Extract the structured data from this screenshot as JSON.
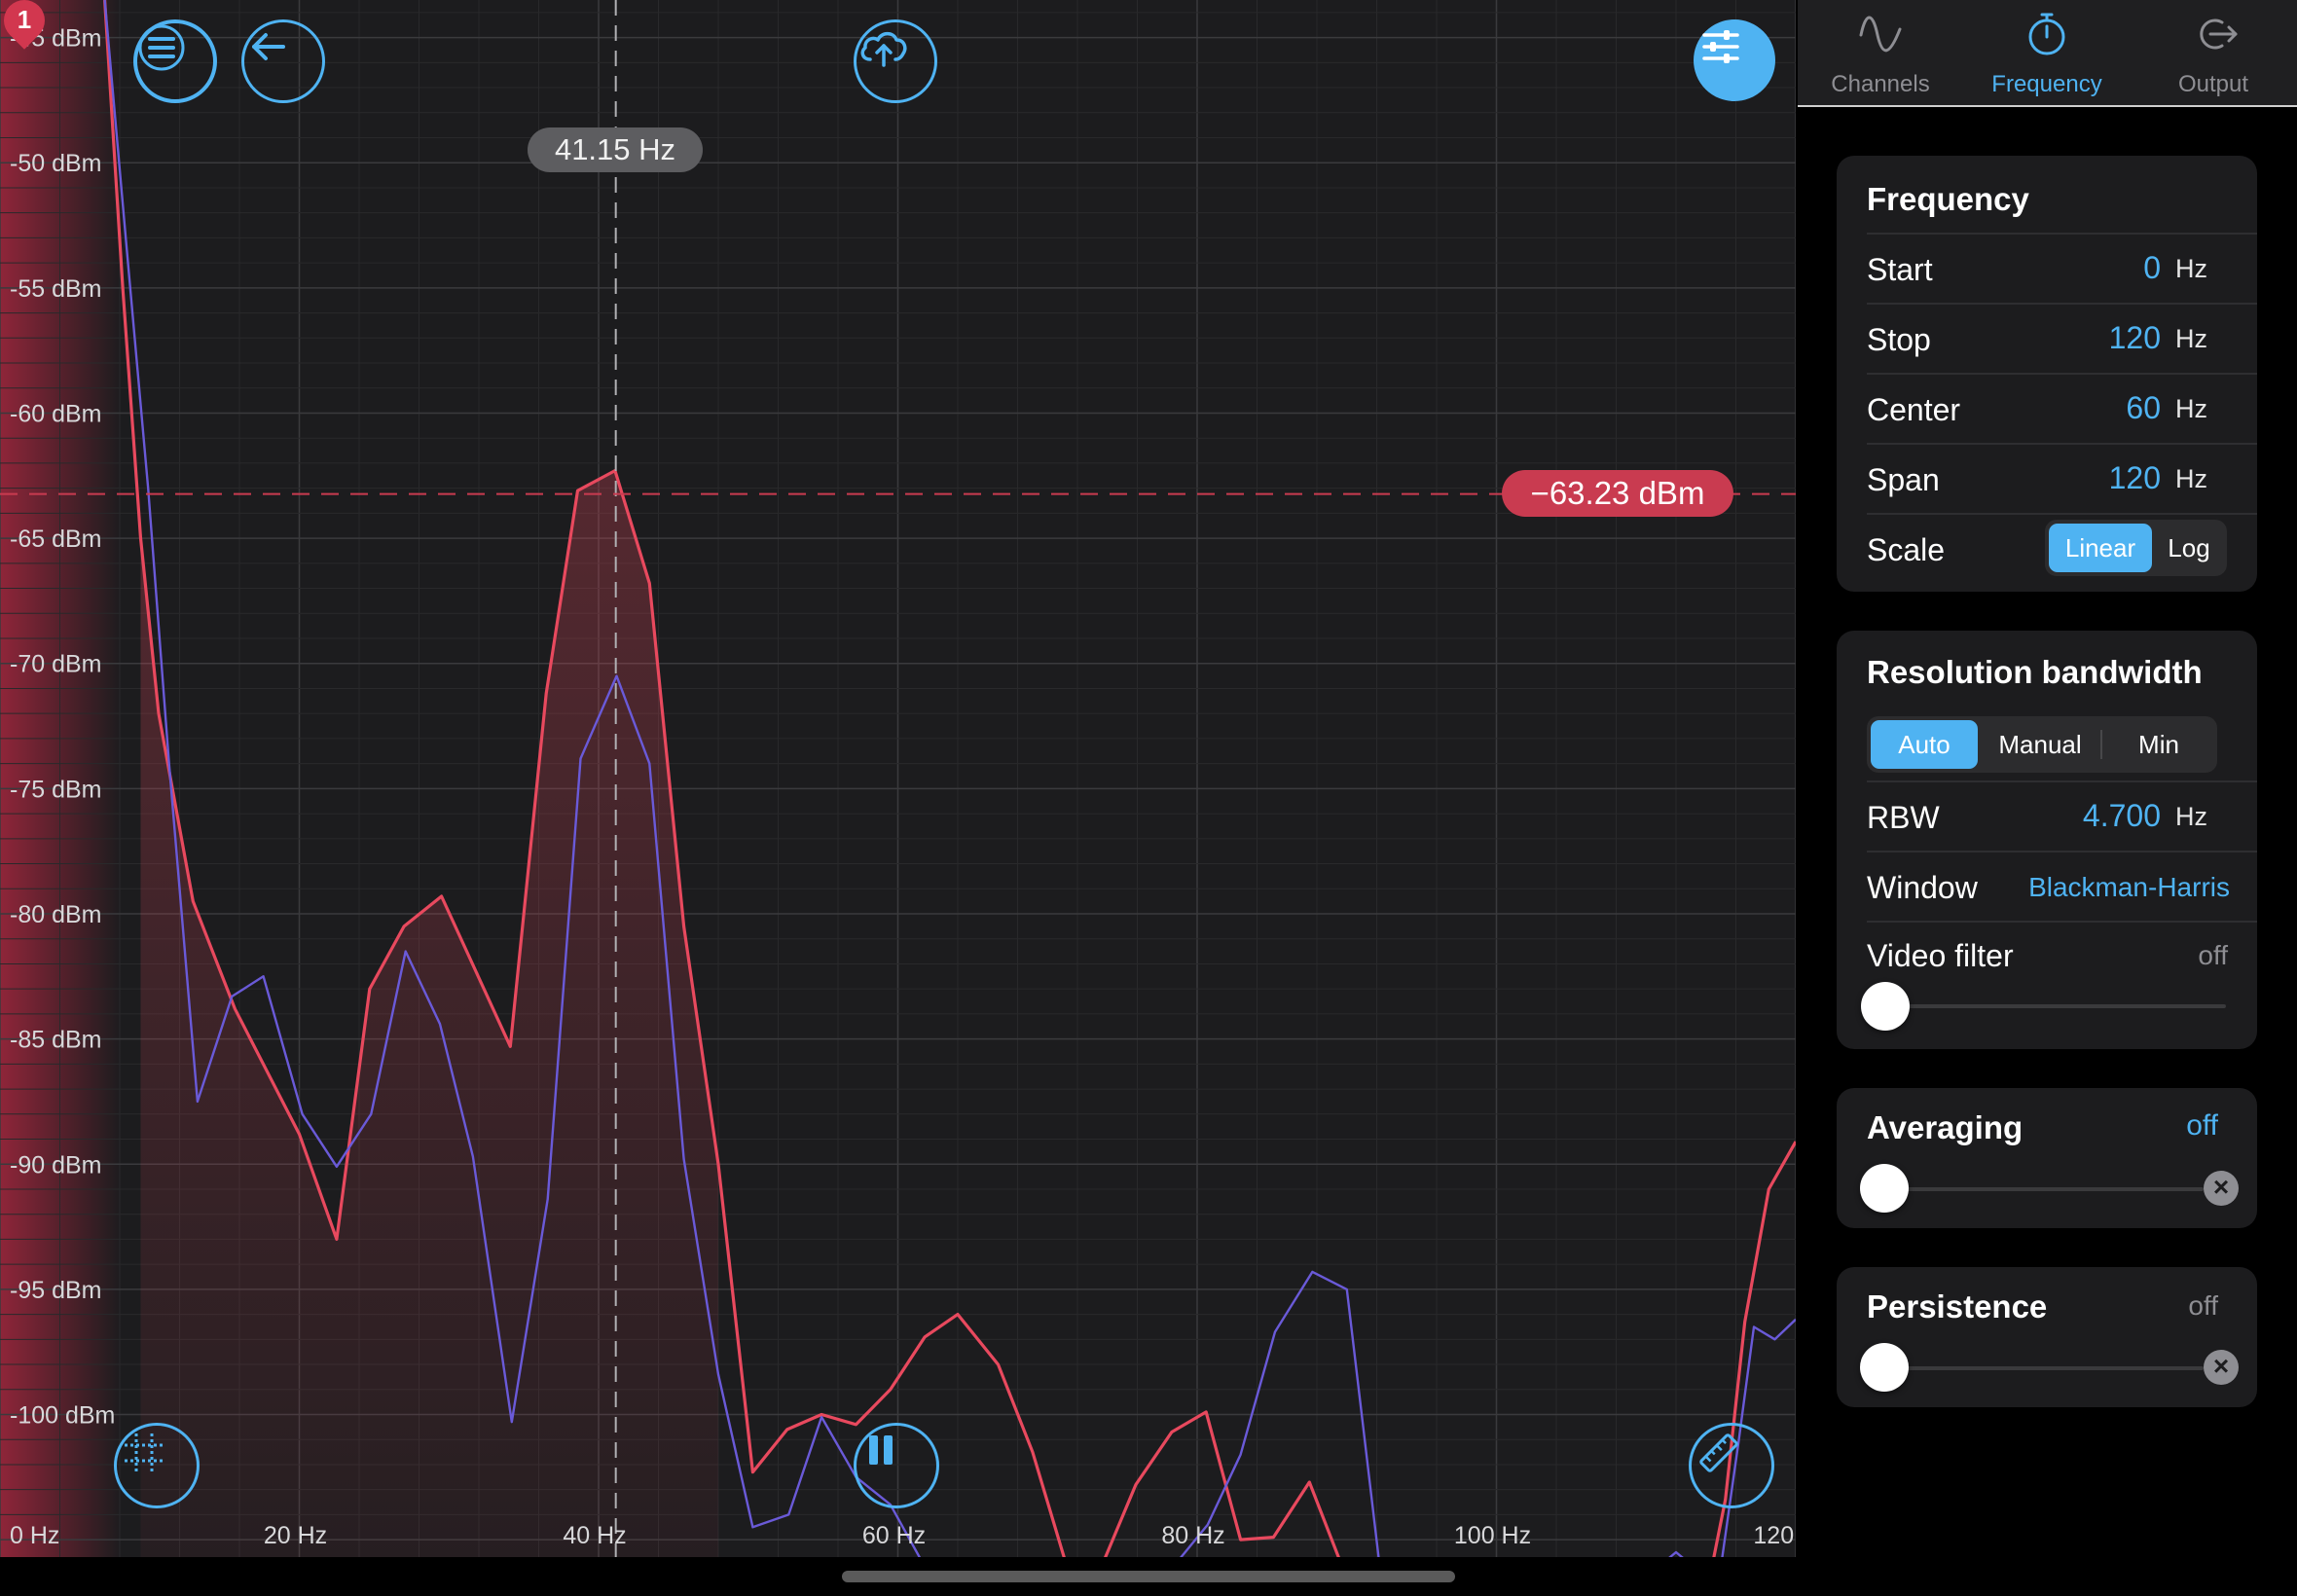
{
  "chart_data": {
    "type": "line",
    "title": "",
    "xlabel": "",
    "ylabel": "",
    "xlim": [
      0,
      120
    ],
    "ylim": [
      -105.5,
      -43.5
    ],
    "grid": true,
    "x_ticks": [
      {
        "value": 0,
        "label": "0 Hz"
      },
      {
        "value": 20,
        "label": "20 Hz"
      },
      {
        "value": 40,
        "label": "40 Hz"
      },
      {
        "value": 60,
        "label": "60 Hz"
      },
      {
        "value": 80,
        "label": "80 Hz"
      },
      {
        "value": 100,
        "label": "100 Hz"
      },
      {
        "value": 120,
        "label": "120 Hz"
      }
    ],
    "y_ticks": [
      {
        "value": -45,
        "label": "-45 dBm"
      },
      {
        "value": -50,
        "label": "-50 dBm"
      },
      {
        "value": -55,
        "label": "-55 dBm"
      },
      {
        "value": -60,
        "label": "-60 dBm"
      },
      {
        "value": -65,
        "label": "-65 dBm"
      },
      {
        "value": -70,
        "label": "-70 dBm"
      },
      {
        "value": -75,
        "label": "-75 dBm"
      },
      {
        "value": -80,
        "label": "-80 dBm"
      },
      {
        "value": -85,
        "label": "-85 dBm"
      },
      {
        "value": -90,
        "label": "-90 dBm"
      },
      {
        "value": -95,
        "label": "-95 dBm"
      },
      {
        "value": -100,
        "label": "-100 dBm"
      }
    ],
    "series": [
      {
        "color": "#e8495e",
        "x": [
          7.0,
          8.2,
          9.4,
          10.6,
          12.9,
          15.7,
          20.0,
          22.5,
          24.7,
          27.0,
          29.5,
          34.1,
          36.5,
          38.6,
          41.1,
          43.4,
          45.7,
          48.0,
          50.3,
          52.6,
          54.9,
          57.2,
          59.5,
          61.8,
          64.0,
          66.7,
          69.0,
          71.3,
          73.6,
          75.9,
          78.3,
          80.6,
          82.9,
          85.1,
          87.5,
          89.7,
          92.0,
          94.3,
          114.4,
          115.3,
          116.6,
          118.2,
          120.0
        ],
        "y": [
          -43.5,
          -55.0,
          -65.0,
          -72.0,
          -79.5,
          -83.8,
          -88.8,
          -93.0,
          -83.0,
          -80.5,
          -79.3,
          -85.3,
          -71.2,
          -63.1,
          -62.3,
          -66.8,
          -80.5,
          -90.0,
          -102.3,
          -100.6,
          -100.0,
          -100.4,
          -99.0,
          -96.9,
          -96.0,
          -98.0,
          -101.5,
          -109.0,
          -109.0,
          -102.8,
          -100.7,
          -99.9,
          -105.0,
          -104.9,
          -102.7,
          -109.0,
          -109.0,
          -109.0,
          -109.0,
          -103.4,
          -96.3,
          -91.0,
          -89.1
        ]
      },
      {
        "color": "#6a5ad8",
        "x": [
          7.0,
          8.4,
          9.9,
          11.3,
          13.2,
          15.5,
          17.6,
          20.2,
          22.5,
          24.8,
          27.1,
          29.4,
          31.6,
          34.2,
          36.6,
          38.8,
          41.2,
          43.4,
          45.7,
          48.0,
          50.3,
          52.7,
          54.9,
          57.2,
          59.5,
          61.8,
          64.2,
          66.6,
          69.3,
          71.6,
          73.9,
          76.2,
          78.4,
          80.7,
          82.9,
          85.2,
          87.7,
          90.0,
          92.2,
          94.5,
          99.5,
          104.5,
          109.0,
          110.4,
          111.0,
          112.0,
          113.0,
          114.0,
          115.0,
          116.2,
          117.2,
          118.6,
          120.0
        ],
        "y": [
          -43.5,
          -53.0,
          -63.0,
          -74.0,
          -87.5,
          -83.3,
          -82.5,
          -88.0,
          -90.1,
          -88.0,
          -81.5,
          -84.4,
          -89.7,
          -100.3,
          -91.4,
          -73.8,
          -70.5,
          -74.0,
          -89.8,
          -98.4,
          -104.5,
          -104.0,
          -100.1,
          -102.5,
          -103.6,
          -108.0,
          -108.0,
          -109.0,
          -109.0,
          -108.8,
          -108.5,
          -109.0,
          -109.0,
          -104.4,
          -101.6,
          -96.7,
          -94.3,
          -95.0,
          -109.0,
          -109.0,
          -109.0,
          -109.0,
          -109.0,
          -106.9,
          -106.0,
          -105.5,
          -106.0,
          -108.5,
          -106.7,
          -101.0,
          -96.5,
          -97.0,
          -96.2
        ]
      }
    ]
  },
  "cursor": {
    "frequency_label": "41.15 Hz",
    "frequency_value": 41.15,
    "level_label": "−63.23 dBm",
    "level_value": -63.23
  },
  "marker": {
    "number": "1"
  },
  "toolbar": {
    "menu_icon": "menu-icon",
    "back_icon": "back-arrow-icon",
    "upload_icon": "cloud-upload-icon",
    "settings_icon": "sliders-icon",
    "grid_icon": "grid-icon",
    "pause_icon": "pause-icon",
    "ruler_icon": "ruler-icon"
  },
  "tabs": [
    {
      "label": "Channels",
      "icon": "sine-wave-icon",
      "active": false
    },
    {
      "label": "Frequency",
      "icon": "stopwatch-icon",
      "active": true
    },
    {
      "label": "Output",
      "icon": "output-arrow-icon",
      "active": false
    }
  ],
  "frequency": {
    "title": "Frequency",
    "start": {
      "label": "Start",
      "value": "0",
      "unit": "Hz"
    },
    "stop": {
      "label": "Stop",
      "value": "120",
      "unit": "Hz"
    },
    "center": {
      "label": "Center",
      "value": "60",
      "unit": "Hz"
    },
    "span": {
      "label": "Span",
      "value": "120",
      "unit": "Hz"
    },
    "scale": {
      "label": "Scale",
      "options": [
        "Linear",
        "Log"
      ],
      "selected": "Linear"
    }
  },
  "rbw": {
    "title": "Resolution bandwidth",
    "modes": [
      "Auto",
      "Manual",
      "Min"
    ],
    "selected": "Auto",
    "rbw": {
      "label": "RBW",
      "value": "4.700",
      "unit": "Hz"
    },
    "window": {
      "label": "Window",
      "value": "Blackman-Harris"
    },
    "video_filter": {
      "label": "Video filter",
      "value": "off",
      "level": 0
    }
  },
  "averaging": {
    "title": "Averaging",
    "value": "off",
    "level": 0
  },
  "persistence": {
    "title": "Persistence",
    "value": "off",
    "level": 0
  },
  "colors": {
    "accent": "#4fb3f2",
    "trace_a": "#e8495e",
    "trace_b": "#6a5ad8",
    "level_tag": "#c93b50"
  }
}
